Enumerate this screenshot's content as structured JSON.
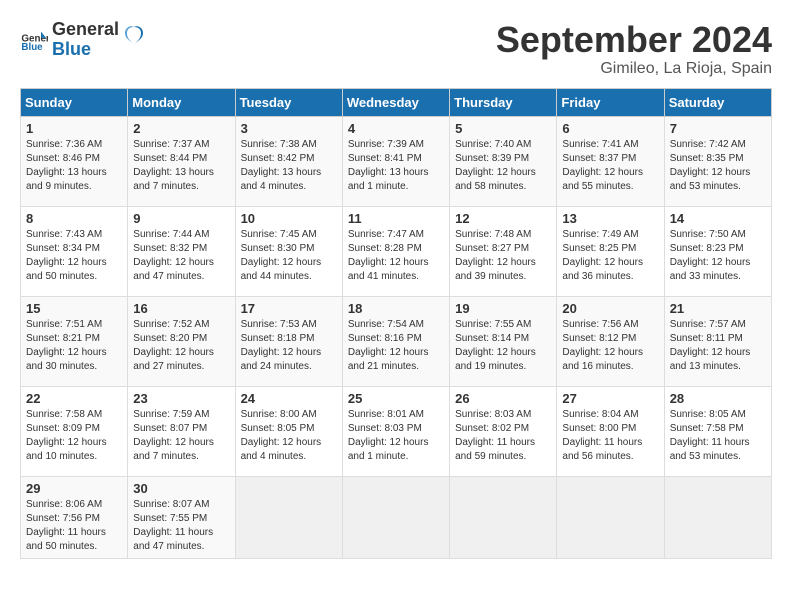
{
  "logo": {
    "general": "General",
    "blue": "Blue"
  },
  "title": "September 2024",
  "location": "Gimileo, La Rioja, Spain",
  "days_of_week": [
    "Sunday",
    "Monday",
    "Tuesday",
    "Wednesday",
    "Thursday",
    "Friday",
    "Saturday"
  ],
  "weeks": [
    [
      {
        "day": 1,
        "sunrise": "7:36 AM",
        "sunset": "8:46 PM",
        "daylight": "13 hours and 9 minutes."
      },
      {
        "day": 2,
        "sunrise": "7:37 AM",
        "sunset": "8:44 PM",
        "daylight": "13 hours and 7 minutes."
      },
      {
        "day": 3,
        "sunrise": "7:38 AM",
        "sunset": "8:42 PM",
        "daylight": "13 hours and 4 minutes."
      },
      {
        "day": 4,
        "sunrise": "7:39 AM",
        "sunset": "8:41 PM",
        "daylight": "13 hours and 1 minute."
      },
      {
        "day": 5,
        "sunrise": "7:40 AM",
        "sunset": "8:39 PM",
        "daylight": "12 hours and 58 minutes."
      },
      {
        "day": 6,
        "sunrise": "7:41 AM",
        "sunset": "8:37 PM",
        "daylight": "12 hours and 55 minutes."
      },
      {
        "day": 7,
        "sunrise": "7:42 AM",
        "sunset": "8:35 PM",
        "daylight": "12 hours and 53 minutes."
      }
    ],
    [
      {
        "day": 8,
        "sunrise": "7:43 AM",
        "sunset": "8:34 PM",
        "daylight": "12 hours and 50 minutes."
      },
      {
        "day": 9,
        "sunrise": "7:44 AM",
        "sunset": "8:32 PM",
        "daylight": "12 hours and 47 minutes."
      },
      {
        "day": 10,
        "sunrise": "7:45 AM",
        "sunset": "8:30 PM",
        "daylight": "12 hours and 44 minutes."
      },
      {
        "day": 11,
        "sunrise": "7:47 AM",
        "sunset": "8:28 PM",
        "daylight": "12 hours and 41 minutes."
      },
      {
        "day": 12,
        "sunrise": "7:48 AM",
        "sunset": "8:27 PM",
        "daylight": "12 hours and 39 minutes."
      },
      {
        "day": 13,
        "sunrise": "7:49 AM",
        "sunset": "8:25 PM",
        "daylight": "12 hours and 36 minutes."
      },
      {
        "day": 14,
        "sunrise": "7:50 AM",
        "sunset": "8:23 PM",
        "daylight": "12 hours and 33 minutes."
      }
    ],
    [
      {
        "day": 15,
        "sunrise": "7:51 AM",
        "sunset": "8:21 PM",
        "daylight": "12 hours and 30 minutes."
      },
      {
        "day": 16,
        "sunrise": "7:52 AM",
        "sunset": "8:20 PM",
        "daylight": "12 hours and 27 minutes."
      },
      {
        "day": 17,
        "sunrise": "7:53 AM",
        "sunset": "8:18 PM",
        "daylight": "12 hours and 24 minutes."
      },
      {
        "day": 18,
        "sunrise": "7:54 AM",
        "sunset": "8:16 PM",
        "daylight": "12 hours and 21 minutes."
      },
      {
        "day": 19,
        "sunrise": "7:55 AM",
        "sunset": "8:14 PM",
        "daylight": "12 hours and 19 minutes."
      },
      {
        "day": 20,
        "sunrise": "7:56 AM",
        "sunset": "8:12 PM",
        "daylight": "12 hours and 16 minutes."
      },
      {
        "day": 21,
        "sunrise": "7:57 AM",
        "sunset": "8:11 PM",
        "daylight": "12 hours and 13 minutes."
      }
    ],
    [
      {
        "day": 22,
        "sunrise": "7:58 AM",
        "sunset": "8:09 PM",
        "daylight": "12 hours and 10 minutes."
      },
      {
        "day": 23,
        "sunrise": "7:59 AM",
        "sunset": "8:07 PM",
        "daylight": "12 hours and 7 minutes."
      },
      {
        "day": 24,
        "sunrise": "8:00 AM",
        "sunset": "8:05 PM",
        "daylight": "12 hours and 4 minutes."
      },
      {
        "day": 25,
        "sunrise": "8:01 AM",
        "sunset": "8:03 PM",
        "daylight": "12 hours and 1 minute."
      },
      {
        "day": 26,
        "sunrise": "8:03 AM",
        "sunset": "8:02 PM",
        "daylight": "11 hours and 59 minutes."
      },
      {
        "day": 27,
        "sunrise": "8:04 AM",
        "sunset": "8:00 PM",
        "daylight": "11 hours and 56 minutes."
      },
      {
        "day": 28,
        "sunrise": "8:05 AM",
        "sunset": "7:58 PM",
        "daylight": "11 hours and 53 minutes."
      }
    ],
    [
      {
        "day": 29,
        "sunrise": "8:06 AM",
        "sunset": "7:56 PM",
        "daylight": "11 hours and 50 minutes."
      },
      {
        "day": 30,
        "sunrise": "8:07 AM",
        "sunset": "7:55 PM",
        "daylight": "11 hours and 47 minutes."
      },
      null,
      null,
      null,
      null,
      null
    ]
  ]
}
